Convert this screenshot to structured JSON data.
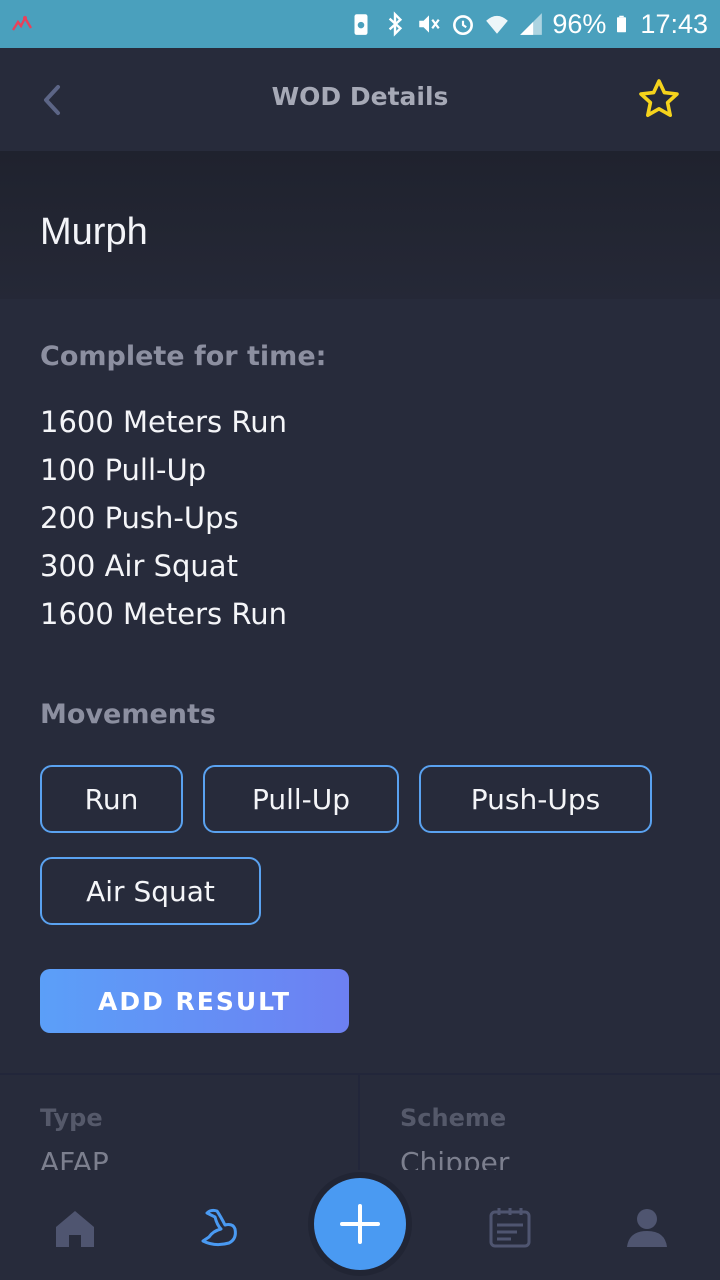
{
  "status_bar": {
    "battery_text": "96%",
    "time": "17:43",
    "icons": [
      "app-notification-icon",
      "battery-saver-icon",
      "bluetooth-icon",
      "mute-icon",
      "alarm-icon",
      "wifi-icon",
      "signal-icon",
      "battery-icon"
    ]
  },
  "header": {
    "title": "WOD Details",
    "back_icon": "chevron-left-icon",
    "favorite_icon": "star-outline-icon",
    "favorite_color": "#f5d31c"
  },
  "wod": {
    "name": "Murph",
    "description_heading": "Complete for time:",
    "description_lines": [
      "1600 Meters Run",
      "100 Pull-Up",
      "200 Push-Ups",
      "300 Air Squat",
      "1600 Meters Run"
    ],
    "movements_heading": "Movements",
    "movements": [
      "Run",
      "Pull-Up",
      "Push-Ups",
      "Air Squat"
    ],
    "add_result_label": "ADD RESULT"
  },
  "info": {
    "type_label": "Type",
    "type_value": "AFAP",
    "scheme_label": "Scheme",
    "scheme_value": "Chipper"
  },
  "bottom_nav": {
    "items": [
      "home-icon",
      "muscle-icon",
      "add-icon",
      "calendar-icon",
      "profile-icon"
    ],
    "active_color": "#4a9af2",
    "inactive_color": "#4f5570"
  },
  "colors": {
    "background": "#272b3b",
    "accent": "#5aa2f0",
    "status_bar": "#4aa0bd"
  }
}
